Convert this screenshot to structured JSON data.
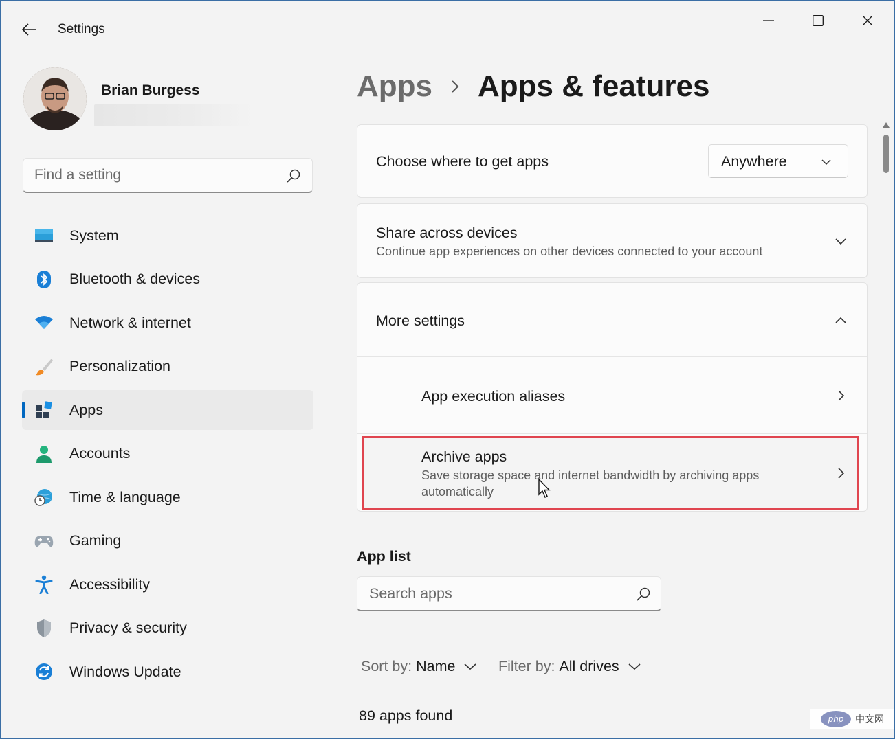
{
  "window": {
    "title": "Settings",
    "accent": "#0067c0",
    "highlight_color": "#e0454f"
  },
  "profile": {
    "name": "Brian Burgess"
  },
  "search": {
    "placeholder": "Find a setting"
  },
  "sidebar": {
    "items": [
      {
        "label": "System",
        "icon": "monitor-icon"
      },
      {
        "label": "Bluetooth & devices",
        "icon": "bluetooth-icon"
      },
      {
        "label": "Network & internet",
        "icon": "wifi-icon"
      },
      {
        "label": "Personalization",
        "icon": "brush-icon"
      },
      {
        "label": "Apps",
        "icon": "apps-icon",
        "selected": true
      },
      {
        "label": "Accounts",
        "icon": "person-icon"
      },
      {
        "label": "Time & language",
        "icon": "globe-clock-icon"
      },
      {
        "label": "Gaming",
        "icon": "gamepad-icon"
      },
      {
        "label": "Accessibility",
        "icon": "accessibility-icon"
      },
      {
        "label": "Privacy & security",
        "icon": "shield-icon"
      },
      {
        "label": "Windows Update",
        "icon": "update-icon"
      }
    ]
  },
  "breadcrumb": {
    "parent": "Apps",
    "current": "Apps & features"
  },
  "main": {
    "choose_source": {
      "label": "Choose where to get apps",
      "value": "Anywhere"
    },
    "share": {
      "title": "Share across devices",
      "subtitle": "Continue app experiences on other devices connected to your account"
    },
    "more_settings": {
      "title": "More settings",
      "aliases": "App execution aliases",
      "archive_title": "Archive apps",
      "archive_sub_1": "Save storage space and internet bandwidth by archiving apps",
      "archive_sub_2": "automatically"
    },
    "app_list": {
      "title": "App list",
      "search_placeholder": "Search apps",
      "sort_label": "Sort by:",
      "sort_value": "Name",
      "filter_label": "Filter by:",
      "filter_value": "All drives",
      "count": "89 apps found"
    }
  },
  "watermark": {
    "logo": "php",
    "text": "中文网"
  }
}
